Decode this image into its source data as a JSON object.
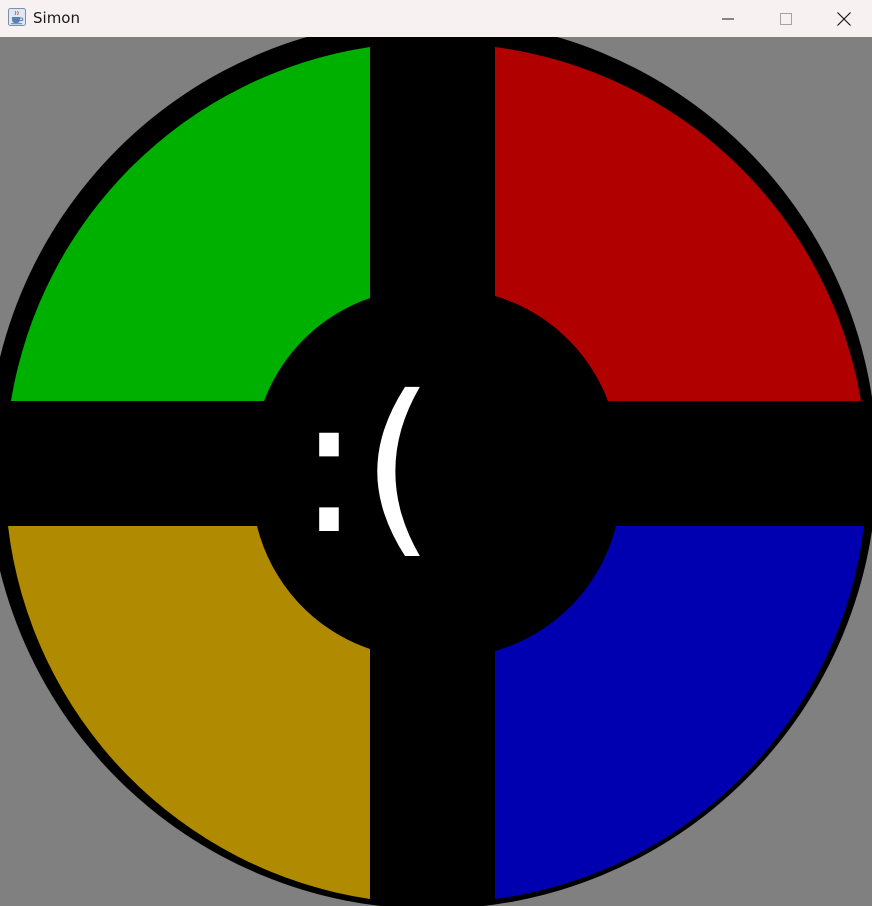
{
  "window": {
    "title": "Simon",
    "icon": "java-cup-icon",
    "controls": {
      "minimize": "minimize-icon",
      "maximize": "maximize-icon",
      "close": "close-icon"
    }
  },
  "board": {
    "background_color": "#808080",
    "ring_color": "#000000",
    "center_text": ":(",
    "center_text_color": "#ffffff",
    "pads": [
      {
        "id": "green",
        "color": "#00b000"
      },
      {
        "id": "red",
        "color": "#b00000"
      },
      {
        "id": "yellow",
        "color": "#b08a00"
      },
      {
        "id": "blue",
        "color": "#0000b0"
      }
    ]
  }
}
